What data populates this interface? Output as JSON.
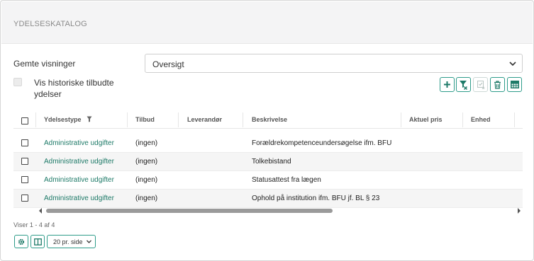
{
  "header": {
    "title": "YDELSESKATALOG"
  },
  "views": {
    "label": "Gemte visninger",
    "selected": "Oversigt"
  },
  "historic": {
    "label": "Vis historiske tilbudte ydelser",
    "checked": false
  },
  "toolbar": {
    "buttons": [
      {
        "name": "add-button",
        "icon": "plus-icon"
      },
      {
        "name": "clear-filter-button",
        "icon": "filter-clear-icon"
      },
      {
        "name": "approve-button",
        "icon": "check-clipboard-icon",
        "disabled": true
      },
      {
        "name": "delete-button",
        "icon": "trash-icon"
      },
      {
        "name": "export-button",
        "icon": "table-grid-icon"
      }
    ]
  },
  "table": {
    "columns": [
      "Ydelsestype",
      "Tilbud",
      "Leverandør",
      "Beskrivelse",
      "Aktuel pris",
      "Enhed"
    ],
    "rows": [
      {
        "type": "Administrative udgifter",
        "offer": "(ingen)",
        "supplier": "",
        "description": "Forældrekompetenceundersøgelse ifm. BFU",
        "price": "",
        "unit": ""
      },
      {
        "type": "Administrative udgifter",
        "offer": "(ingen)",
        "supplier": "",
        "description": "Tolkebistand",
        "price": "",
        "unit": ""
      },
      {
        "type": "Administrative udgifter",
        "offer": "(ingen)",
        "supplier": "",
        "description": "Statusattest fra lægen",
        "price": "",
        "unit": ""
      },
      {
        "type": "Administrative udgifter",
        "offer": "(ingen)",
        "supplier": "",
        "description": "Ophold på institution ifm. BFU jf. BL § 23",
        "price": "",
        "unit": ""
      }
    ]
  },
  "footer": {
    "count": "Viser 1 - 4 af 4",
    "page_size": "20 pr. side"
  },
  "colors": {
    "accent": "#2e9c8a",
    "link": "#1e7a68",
    "header_bg": "#f4f4f5"
  }
}
